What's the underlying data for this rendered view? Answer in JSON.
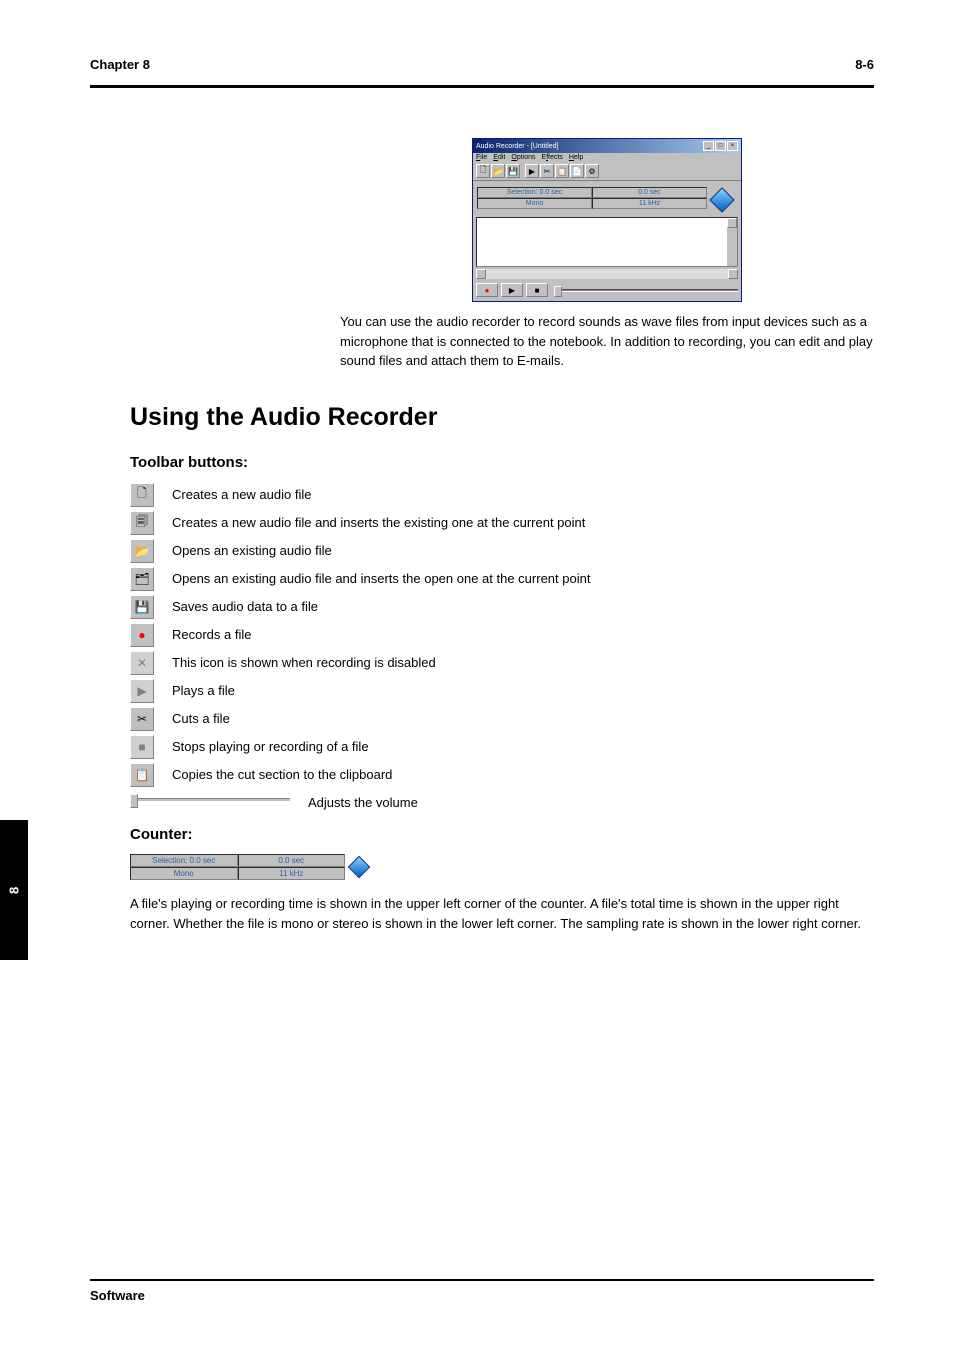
{
  "header": {
    "chapter": "Chapter 8",
    "page_number": "8-6"
  },
  "app_window": {
    "title": "Audio Recorder - [Untitled]",
    "menu": [
      "File",
      "Edit",
      "Options",
      "Effects",
      "Help"
    ],
    "status": {
      "sel_label": "Selection: 0.0 sec",
      "duration": "0.0 sec",
      "mono": "Mono",
      "rate": "11 kHz"
    }
  },
  "intro": "You can use the audio recorder to record sounds as wave files from input devices such as a microphone that is connected to the notebook. In addition to recording, you can edit and play sound files and attach them to E-mails.",
  "section_title": "Using the Audio Recorder",
  "toolbar_heading": "Toolbar buttons:",
  "icons": {
    "new": "Creates a new audio file",
    "new_insert": "Creates a new audio file and inserts the existing one at the current point",
    "open": "Opens an existing audio file",
    "open_insert": "Opens an existing audio file and inserts the open one at the current point",
    "save": "Saves audio data to a file",
    "record": "Records a file",
    "record_disabled": "This icon is shown when recording is disabled",
    "play": "Plays a file",
    "cut": "Cuts a file",
    "stop": "Stops playing or recording of a file",
    "copy": "Copies the cut section to the clipboard"
  },
  "slider_label": "Adjusts the volume",
  "counter_heading": "Counter:",
  "counter": {
    "sel": "Selection: 0.0 sec",
    "dur": "0.0 sec",
    "mono": "Mono",
    "rate": "11 kHz"
  },
  "counter_text": "A file's playing or recording time is shown in the upper left corner of the counter. A file's total time is shown in the upper right corner. Whether the file is mono or stereo is shown in the lower left corner. The sampling rate is shown in the lower right corner.",
  "footer": "Software"
}
